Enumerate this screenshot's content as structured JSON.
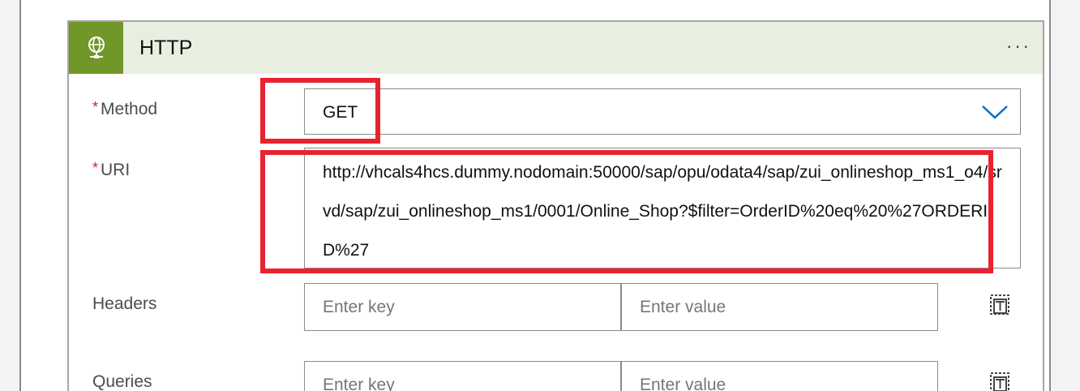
{
  "header": {
    "title": "HTTP",
    "icon": "globe-network-icon",
    "more_label": "···",
    "accent": "#709727"
  },
  "method": {
    "label": "Method",
    "required_mark": "*",
    "value": "GET"
  },
  "uri": {
    "label": "URI",
    "required_mark": "*",
    "value": "http://vhcals4hcs.dummy.nodomain:50000/sap/opu/odata4/sap/zui_onlineshop_ms1_o4/srvd/sap/zui_onlineshop_ms1/0001/Online_Shop?$filter=OrderID%20eq%20%27ORDERID%27"
  },
  "headers": {
    "label": "Headers",
    "key_placeholder": "Enter key",
    "value_placeholder": "Enter value"
  },
  "queries": {
    "label": "Queries",
    "key_placeholder": "Enter key",
    "value_placeholder": "Enter value"
  },
  "colors": {
    "highlight": "#e8232f",
    "required": "#c4262e",
    "chevron": "#0f6cbd",
    "header_bg": "#e9efe0"
  }
}
